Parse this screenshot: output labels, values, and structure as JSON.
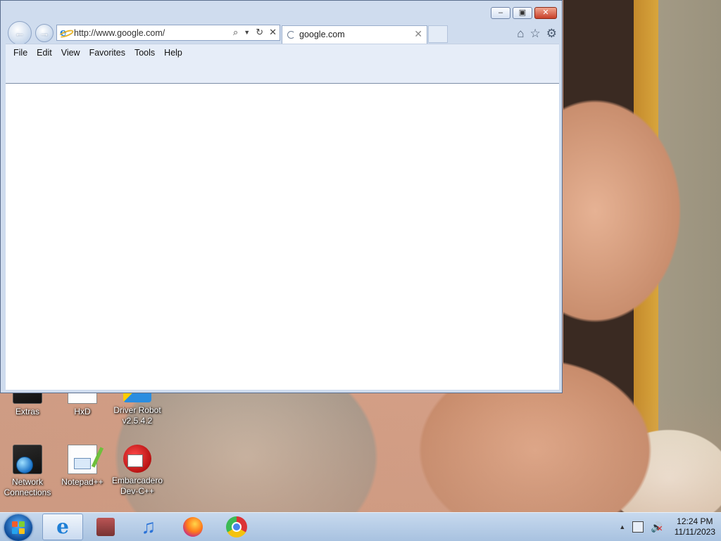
{
  "browser": {
    "url": "http://www.google.com/",
    "tab_title": "google.com",
    "menu": [
      "File",
      "Edit",
      "View",
      "Favorites",
      "Tools",
      "Help"
    ],
    "window_controls": {
      "minimize": "minimize-icon",
      "restore": "restore-icon",
      "close": "close-icon"
    }
  },
  "desktop": {
    "icons": [
      {
        "label": "Extras"
      },
      {
        "label": "HxD"
      },
      {
        "label": "Driver Robot v2.5.4.2"
      },
      {
        "label": "Network Connections"
      },
      {
        "label": "Notepad++"
      },
      {
        "label": "Embarcadero Dev-C++"
      }
    ]
  },
  "taskbar": {
    "pinned": [
      "internet-explorer-icon",
      "winrar-icon",
      "itunes-icon",
      "firefox-icon",
      "chrome-icon"
    ],
    "clock": {
      "time": "12:24 PM",
      "date": "11/11/2023"
    }
  }
}
